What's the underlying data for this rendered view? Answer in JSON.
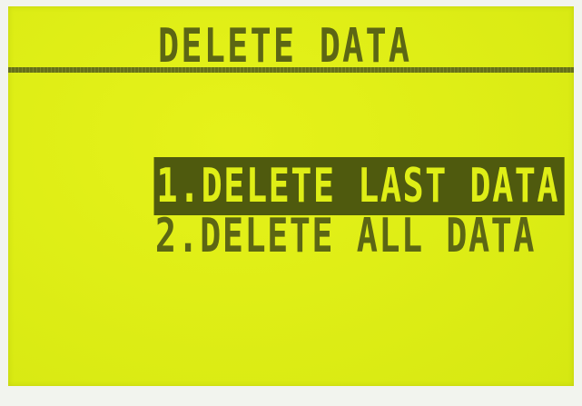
{
  "screen": {
    "title": "DELETE DATA",
    "menu": {
      "items": [
        {
          "label": "1.DELETE LAST DATA",
          "selected": true
        },
        {
          "label": "2.DELETE ALL DATA",
          "selected": false
        }
      ]
    }
  },
  "colors": {
    "lcd_background": "#e0ef16",
    "lcd_ink": "#5c6614",
    "highlight_background": "#4f5a0e"
  }
}
